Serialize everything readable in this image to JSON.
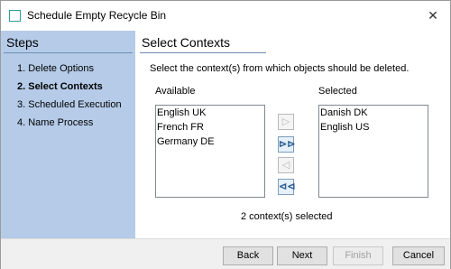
{
  "window": {
    "title": "Schedule Empty Recycle Bin",
    "close_glyph": "✕"
  },
  "steps": {
    "title": "Steps",
    "items": [
      {
        "label": "1. Delete Options"
      },
      {
        "label": "2. Select Contexts"
      },
      {
        "label": "3. Scheduled Execution"
      },
      {
        "label": "4. Name Process"
      }
    ]
  },
  "main": {
    "title": "Select Contexts",
    "instruction": "Select the context(s) from which objects should be deleted.",
    "available_label": "Available",
    "selected_label": "Selected",
    "available": [
      "English UK",
      "French FR",
      "Germany DE"
    ],
    "selected": [
      "Danish DK",
      "English US"
    ],
    "count_text": "2 context(s) selected"
  },
  "icons": {
    "add": "▷",
    "add_all": "⊳⊳",
    "remove": "◁",
    "remove_all": "⊲⊲"
  },
  "buttons": {
    "back": "Back",
    "next": "Next",
    "finish": "Finish",
    "cancel": "Cancel"
  }
}
